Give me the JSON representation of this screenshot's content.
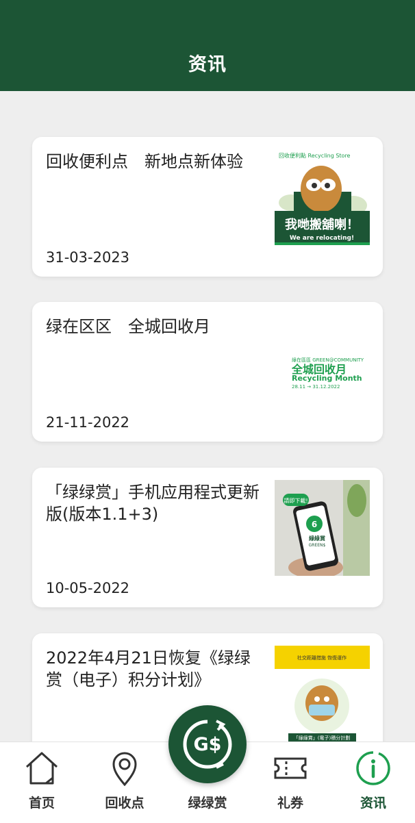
{
  "header": {
    "title": "资讯"
  },
  "news": [
    {
      "title": "回收便利点　新地点新体验",
      "date": "31-03-2023",
      "thumb": {
        "text_cn": "我哋搬舖喇！",
        "text_en": "We are relocating!",
        "small": "回收便利點 Recycling Store"
      }
    },
    {
      "title": "绿在区区　全城回收月",
      "date": "21-11-2022",
      "thumb": {
        "small": "綠在區區 GREEN@COMMUNITY",
        "text_cn": "全城回收月",
        "text_en": "Recycling Month",
        "range": "28.11 → 31.12.2022"
      }
    },
    {
      "title": "「绿绿赏」手机应用程式更新版(版本1.1+3)",
      "date": "10-05-2022",
      "thumb": {
        "bubble": "請即下載!",
        "app_name": "綠綠賞",
        "app_en": "GREEN$"
      }
    },
    {
      "title": "2022年4月21日恢复《绿绿赏（电子）积分计划》",
      "date": "",
      "thumb": {
        "top_text": "社交距離措施 恢復運作",
        "caption": "「綠綠賞」(電子)積分計劃"
      }
    }
  ],
  "tabbar": {
    "home": {
      "label": "首页",
      "icon": "home-icon"
    },
    "recycle_points": {
      "label": "回收点",
      "icon": "map-pin-icon"
    },
    "rewards": {
      "label": "绿绿赏",
      "icon": "g-dollar-icon",
      "fab_text": "G$"
    },
    "coupons": {
      "label": "礼券",
      "icon": "ticket-icon"
    },
    "news": {
      "label": "资讯",
      "icon": "info-icon"
    }
  },
  "colors": {
    "brand_green": "#1c5535",
    "accent_green": "#1e9f4f",
    "background": "#eeeeee",
    "yellow": "#f5d200"
  }
}
